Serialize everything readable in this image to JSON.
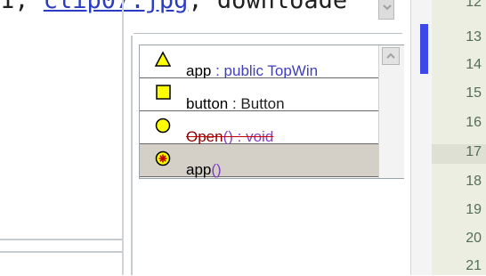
{
  "top_text": {
    "index": "1,",
    "link": "clip07.jpg",
    "tail": ", downloade"
  },
  "completion": {
    "items": [
      {
        "icon": "triangle-icon",
        "name": "app",
        "detail": " : public TopWin"
      },
      {
        "icon": "square-icon",
        "name": "button",
        "detail": " : Button"
      },
      {
        "icon": "circle-icon",
        "name": "Open",
        "detail": "() : void"
      },
      {
        "icon": "star-circle-icon",
        "name": "app",
        "detail": "()"
      }
    ],
    "selected_index": 3
  },
  "gutter": {
    "line_numbers": [
      "12",
      "13",
      "14",
      "15",
      "16",
      "17",
      "18",
      "19",
      "20",
      "21"
    ],
    "current_line": "17"
  },
  "colors": {
    "icon_fill": "#ffff00",
    "scroll_thumb": "#3d48e8",
    "gutter_bg": "#eceee2",
    "line_number": "#546e56",
    "selection_bg": "#d4d0c8",
    "link": "#2a3cc4"
  }
}
